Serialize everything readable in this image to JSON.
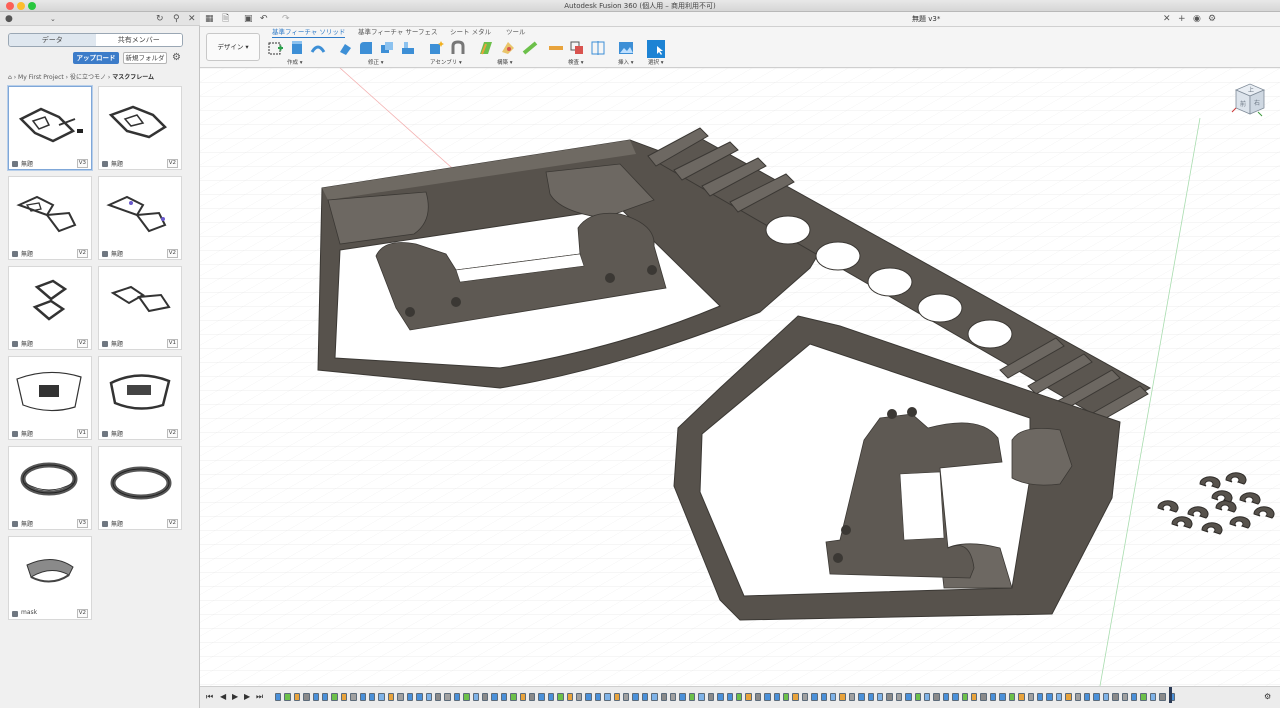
{
  "window": {
    "title": "Autodesk Fusion 360 (個人用 – 商用利用不可)"
  },
  "data_panel": {
    "tabs": [
      {
        "label": "データ"
      },
      {
        "label": "共有メンバー"
      }
    ],
    "upload_label": "アップロード",
    "new_folder_label": "新規フォルダ",
    "breadcrumb": {
      "root": "My First Project",
      "middle": "役に立つモノ",
      "current": "マスクフレーム"
    },
    "files": [
      {
        "name": "無題",
        "version": "V3",
        "selected": true
      },
      {
        "name": "無題",
        "version": "V2"
      },
      {
        "name": "無題",
        "version": "V2"
      },
      {
        "name": "無題",
        "version": "V2"
      },
      {
        "name": "無題",
        "version": "V2"
      },
      {
        "name": "無題",
        "version": "V1"
      },
      {
        "name": "無題",
        "version": "V1"
      },
      {
        "name": "無題",
        "version": "V2"
      },
      {
        "name": "無題",
        "version": "V3"
      },
      {
        "name": "無題",
        "version": "V2"
      },
      {
        "name": "mask",
        "version": "V2"
      }
    ]
  },
  "document": {
    "tab_label": "無題 v3*"
  },
  "toolbar": {
    "workspace": "デザイン",
    "tabs": [
      {
        "label": "基準フィーチャ ソリッド",
        "active": true
      },
      {
        "label": "基準フィーチャ サーフェス"
      },
      {
        "label": "シート メタル"
      },
      {
        "label": "ツール"
      }
    ],
    "groups": [
      {
        "label": "作成"
      },
      {
        "label": "修正"
      },
      {
        "label": "アセンブリ"
      },
      {
        "label": "構築"
      },
      {
        "label": "検査"
      },
      {
        "label": "挿入"
      },
      {
        "label": "選択"
      }
    ]
  },
  "viewcube": {
    "top": "上",
    "front": "前",
    "right": "右"
  },
  "colors": {
    "accent": "#2f7bc8",
    "model": "#5f5a54",
    "model_top": "#6e6963",
    "upload": "#3c7cc9"
  }
}
